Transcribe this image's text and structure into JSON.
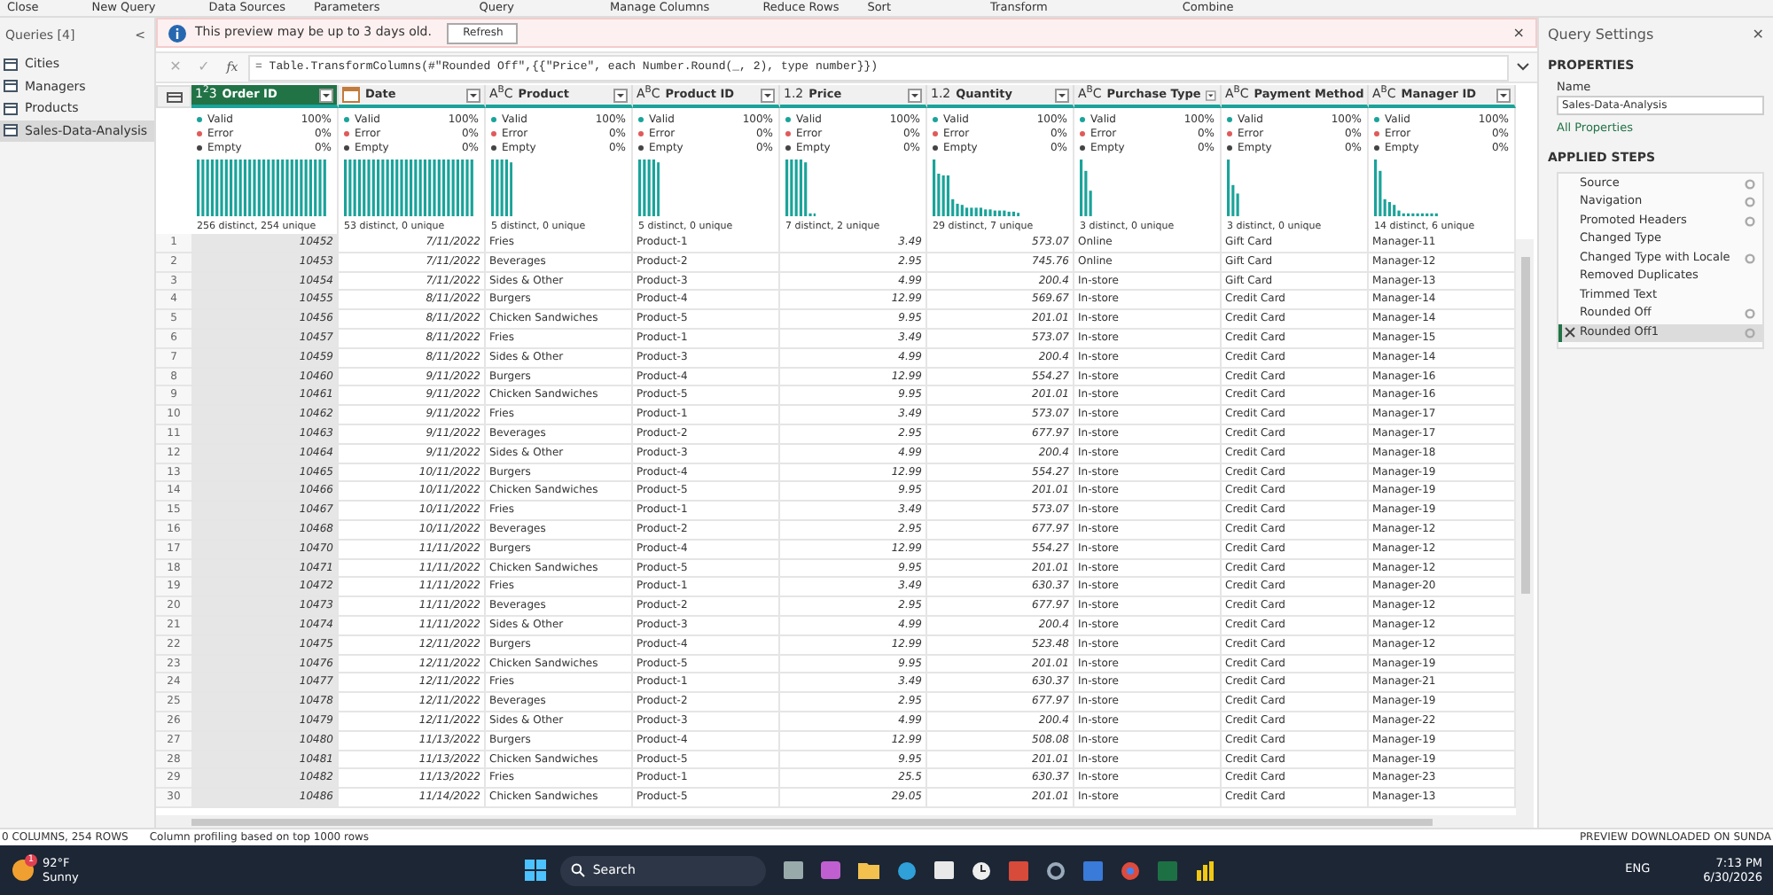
{
  "ribbon_groups": [
    "Close",
    "New Query",
    "Data Sources",
    "Parameters",
    "Query",
    "Manage Columns",
    "Reduce Rows",
    "Sort",
    "Transform",
    "Combine"
  ],
  "queries": {
    "title": "Queries [4]",
    "collapse": "<",
    "items": [
      {
        "name": "Cities",
        "selected": false
      },
      {
        "name": "Managers",
        "selected": false
      },
      {
        "name": "Products",
        "selected": false
      },
      {
        "name": "Sales-Data-Analysis",
        "selected": true
      }
    ]
  },
  "info_bar": {
    "message": "This preview may be up to 3 days old.",
    "button": "Refresh",
    "close": "×"
  },
  "formula_bar": {
    "cancel": "✕",
    "confirm": "✓",
    "fx": "fx",
    "formula": "= Table.TransformColumns(#\"Rounded Off\",{{\"Price\", each Number.Round(_, 2), type number}})"
  },
  "columns": [
    {
      "name": "Order ID",
      "kind": "whole",
      "type_label": "1$^{2}$3",
      "selected": true,
      "profile": [
        {
          "label": "Valid",
          "value": "100%",
          "color": "#1aa39a"
        },
        {
          "label": "Error",
          "value": "0%",
          "color": "#e05a5a"
        },
        {
          "label": "Empty",
          "value": "0%",
          "color": "#444444"
        }
      ],
      "distinct": "256 distinct, 254 unique"
    },
    {
      "name": "Date",
      "kind": "date",
      "selected": false,
      "profile": [
        {
          "label": "Valid",
          "value": "100%",
          "color": "#1aa39a"
        },
        {
          "label": "Error",
          "value": "0%",
          "color": "#e05a5a"
        },
        {
          "label": "Empty",
          "value": "0%",
          "color": "#444444"
        }
      ],
      "distinct": "53 distinct, 0 unique"
    },
    {
      "name": "Product",
      "kind": "text",
      "type_label": "A$^{B}$C",
      "selected": false,
      "profile": [
        {
          "label": "Valid",
          "value": "100%",
          "color": "#1aa39a"
        },
        {
          "label": "Error",
          "value": "0%",
          "color": "#e05a5a"
        },
        {
          "label": "Empty",
          "value": "0%",
          "color": "#444444"
        }
      ],
      "distinct": "5 distinct, 0 unique"
    },
    {
      "name": "Product ID",
      "kind": "text",
      "type_label": "A$^{B}$C",
      "selected": false,
      "profile": [
        {
          "label": "Valid",
          "value": "100%",
          "color": "#1aa39a"
        },
        {
          "label": "Error",
          "value": "0%",
          "color": "#e05a5a"
        },
        {
          "label": "Empty",
          "value": "0%",
          "color": "#444444"
        }
      ],
      "distinct": "5 distinct, 0 unique"
    },
    {
      "name": "Price",
      "kind": "decimal",
      "type_label": "1.2",
      "selected": false,
      "profile": [
        {
          "label": "Valid",
          "value": "100%",
          "color": "#1aa39a"
        },
        {
          "label": "Error",
          "value": "0%",
          "color": "#e05a5a"
        },
        {
          "label": "Empty",
          "value": "0%",
          "color": "#444444"
        }
      ],
      "distinct": "7 distinct, 2 unique"
    },
    {
      "name": "Quantity",
      "kind": "decimal",
      "type_label": "1.2",
      "selected": false,
      "profile": [
        {
          "label": "Valid",
          "value": "100%",
          "color": "#1aa39a"
        },
        {
          "label": "Error",
          "value": "0%",
          "color": "#e05a5a"
        },
        {
          "label": "Empty",
          "value": "0%",
          "color": "#444444"
        }
      ],
      "distinct": "29 distinct, 7 unique"
    },
    {
      "name": "Purchase Type",
      "kind": "text",
      "type_label": "A$^{B}$C",
      "selected": false,
      "profile": [
        {
          "label": "Valid",
          "value": "100%",
          "color": "#1aa39a"
        },
        {
          "label": "Error",
          "value": "0%",
          "color": "#e05a5a"
        },
        {
          "label": "Empty",
          "value": "0%",
          "color": "#444444"
        }
      ],
      "distinct": "3 distinct, 0 unique"
    },
    {
      "name": "Payment Method",
      "kind": "text",
      "type_label": "A$^{B}$C",
      "selected": false,
      "profile": [
        {
          "label": "Valid",
          "value": "100%",
          "color": "#1aa39a"
        },
        {
          "label": "Error",
          "value": "0%",
          "color": "#e05a5a"
        },
        {
          "label": "Empty",
          "value": "0%",
          "color": "#444444"
        }
      ],
      "distinct": "3 distinct, 0 unique"
    },
    {
      "name": "Manager ID",
      "kind": "text",
      "type_label": "A$^{B}$C",
      "selected": false,
      "profile": [
        {
          "label": "Valid",
          "value": "100%",
          "color": "#1aa39a"
        },
        {
          "label": "Error",
          "value": "0%",
          "color": "#e05a5a"
        },
        {
          "label": "Empty",
          "value": "0%",
          "color": "#444444"
        }
      ],
      "distinct": "14 distinct, 6 unique"
    }
  ],
  "rows": [
    {
      "number": "1",
      "cells": [
        "10452",
        "7/11/2022",
        "Fries",
        "Product-1",
        "3.49",
        "573.07",
        "Online",
        "Gift Card",
        "Manager-11"
      ]
    },
    {
      "number": "2",
      "cells": [
        "10453",
        "7/11/2022",
        "Beverages",
        "Product-2",
        "2.95",
        "745.76",
        "Online",
        "Gift Card",
        "Manager-12"
      ]
    },
    {
      "number": "3",
      "cells": [
        "10454",
        "7/11/2022",
        "Sides & Other",
        "Product-3",
        "4.99",
        "200.4",
        "In-store",
        "Gift Card",
        "Manager-13"
      ]
    },
    {
      "number": "4",
      "cells": [
        "10455",
        "8/11/2022",
        "Burgers",
        "Product-4",
        "12.99",
        "569.67",
        "In-store",
        "Credit Card",
        "Manager-14"
      ]
    },
    {
      "number": "5",
      "cells": [
        "10456",
        "8/11/2022",
        "Chicken Sandwiches",
        "Product-5",
        "9.95",
        "201.01",
        "In-store",
        "Credit Card",
        "Manager-14"
      ]
    },
    {
      "number": "6",
      "cells": [
        "10457",
        "8/11/2022",
        "Fries",
        "Product-1",
        "3.49",
        "573.07",
        "In-store",
        "Credit Card",
        "Manager-15"
      ]
    },
    {
      "number": "7",
      "cells": [
        "10459",
        "8/11/2022",
        "Sides & Other",
        "Product-3",
        "4.99",
        "200.4",
        "In-store",
        "Credit Card",
        "Manager-14"
      ]
    },
    {
      "number": "8",
      "cells": [
        "10460",
        "9/11/2022",
        "Burgers",
        "Product-4",
        "12.99",
        "554.27",
        "In-store",
        "Credit Card",
        "Manager-16"
      ]
    },
    {
      "number": "9",
      "cells": [
        "10461",
        "9/11/2022",
        "Chicken Sandwiches",
        "Product-5",
        "9.95",
        "201.01",
        "In-store",
        "Credit Card",
        "Manager-16"
      ]
    },
    {
      "number": "10",
      "cells": [
        "10462",
        "9/11/2022",
        "Fries",
        "Product-1",
        "3.49",
        "573.07",
        "In-store",
        "Credit Card",
        "Manager-17"
      ]
    },
    {
      "number": "11",
      "cells": [
        "10463",
        "9/11/2022",
        "Beverages",
        "Product-2",
        "2.95",
        "677.97",
        "In-store",
        "Credit Card",
        "Manager-17"
      ]
    },
    {
      "number": "12",
      "cells": [
        "10464",
        "9/11/2022",
        "Sides & Other",
        "Product-3",
        "4.99",
        "200.4",
        "In-store",
        "Credit Card",
        "Manager-18"
      ]
    },
    {
      "number": "13",
      "cells": [
        "10465",
        "10/11/2022",
        "Burgers",
        "Product-4",
        "12.99",
        "554.27",
        "In-store",
        "Credit Card",
        "Manager-19"
      ]
    },
    {
      "number": "14",
      "cells": [
        "10466",
        "10/11/2022",
        "Chicken Sandwiches",
        "Product-5",
        "9.95",
        "201.01",
        "In-store",
        "Credit Card",
        "Manager-19"
      ]
    },
    {
      "number": "15",
      "cells": [
        "10467",
        "10/11/2022",
        "Fries",
        "Product-1",
        "3.49",
        "573.07",
        "In-store",
        "Credit Card",
        "Manager-19"
      ]
    },
    {
      "number": "16",
      "cells": [
        "10468",
        "10/11/2022",
        "Beverages",
        "Product-2",
        "2.95",
        "677.97",
        "In-store",
        "Credit Card",
        "Manager-12"
      ]
    },
    {
      "number": "17",
      "cells": [
        "10470",
        "11/11/2022",
        "Burgers",
        "Product-4",
        "12.99",
        "554.27",
        "In-store",
        "Credit Card",
        "Manager-12"
      ]
    },
    {
      "number": "18",
      "cells": [
        "10471",
        "11/11/2022",
        "Chicken Sandwiches",
        "Product-5",
        "9.95",
        "201.01",
        "In-store",
        "Credit Card",
        "Manager-12"
      ]
    },
    {
      "number": "19",
      "cells": [
        "10472",
        "11/11/2022",
        "Fries",
        "Product-1",
        "3.49",
        "630.37",
        "In-store",
        "Credit Card",
        "Manager-20"
      ]
    },
    {
      "number": "20",
      "cells": [
        "10473",
        "11/11/2022",
        "Beverages",
        "Product-2",
        "2.95",
        "677.97",
        "In-store",
        "Credit Card",
        "Manager-12"
      ]
    },
    {
      "number": "21",
      "cells": [
        "10474",
        "11/11/2022",
        "Sides & Other",
        "Product-3",
        "4.99",
        "200.4",
        "In-store",
        "Credit Card",
        "Manager-12"
      ]
    },
    {
      "number": "22",
      "cells": [
        "10475",
        "12/11/2022",
        "Burgers",
        "Product-4",
        "12.99",
        "523.48",
        "In-store",
        "Credit Card",
        "Manager-12"
      ]
    },
    {
      "number": "23",
      "cells": [
        "10476",
        "12/11/2022",
        "Chicken Sandwiches",
        "Product-5",
        "9.95",
        "201.01",
        "In-store",
        "Credit Card",
        "Manager-19"
      ]
    },
    {
      "number": "24",
      "cells": [
        "10477",
        "12/11/2022",
        "Fries",
        "Product-1",
        "3.49",
        "630.37",
        "In-store",
        "Credit Card",
        "Manager-21"
      ]
    },
    {
      "number": "25",
      "cells": [
        "10478",
        "12/11/2022",
        "Beverages",
        "Product-2",
        "2.95",
        "677.97",
        "In-store",
        "Credit Card",
        "Manager-19"
      ]
    },
    {
      "number": "26",
      "cells": [
        "10479",
        "12/11/2022",
        "Sides & Other",
        "Product-3",
        "4.99",
        "200.4",
        "In-store",
        "Credit Card",
        "Manager-22"
      ]
    },
    {
      "number": "27",
      "cells": [
        "10480",
        "11/13/2022",
        "Burgers",
        "Product-4",
        "12.99",
        "508.08",
        "In-store",
        "Credit Card",
        "Manager-19"
      ]
    },
    {
      "number": "28",
      "cells": [
        "10481",
        "11/13/2022",
        "Chicken Sandwiches",
        "Product-5",
        "9.95",
        "201.01",
        "In-store",
        "Credit Card",
        "Manager-19"
      ]
    },
    {
      "number": "29",
      "cells": [
        "10482",
        "11/13/2022",
        "Fries",
        "Product-1",
        "25.5",
        "630.37",
        "In-store",
        "Credit Card",
        "Manager-23"
      ]
    },
    {
      "number": "30",
      "cells": [
        "10486",
        "11/14/2022",
        "Chicken Sandwiches",
        "Product-5",
        "29.05",
        "201.01",
        "In-store",
        "Credit Card",
        "Manager-13"
      ]
    }
  ],
  "query_settings": {
    "title": "Query Settings",
    "close": "✕",
    "properties_heading": "PROPERTIES",
    "name_label": "Name",
    "name_value": "Sales-Data-Analysis",
    "all_properties": "All Properties",
    "steps_heading": "APPLIED STEPS",
    "steps": [
      {
        "name": "Source",
        "has_settings": true,
        "selected": false
      },
      {
        "name": "Navigation",
        "has_settings": true,
        "selected": false
      },
      {
        "name": "Promoted Headers",
        "has_settings": true,
        "selected": false
      },
      {
        "name": "Changed Type",
        "has_settings": false,
        "selected": false
      },
      {
        "name": "Changed Type with Locale",
        "has_settings": true,
        "selected": false
      },
      {
        "name": "Removed Duplicates",
        "has_settings": false,
        "selected": false
      },
      {
        "name": "Trimmed Text",
        "has_settings": false,
        "selected": false
      },
      {
        "name": "Rounded Off",
        "has_settings": true,
        "selected": false
      },
      {
        "name": "Rounded Off1",
        "has_settings": true,
        "selected": true
      }
    ]
  },
  "status_bar": {
    "left": "0 COLUMNS, 254 ROWS",
    "middle": "Column profiling based on top 1000 rows",
    "right": "PREVIEW DOWNLOADED ON SUNDA"
  },
  "taskbar": {
    "temperature": "92°F",
    "weather": "Sunny",
    "weather_badge": "1",
    "search": "Search",
    "language": "ENG",
    "time": "7:13 PM",
    "date": "6/30/2026"
  }
}
